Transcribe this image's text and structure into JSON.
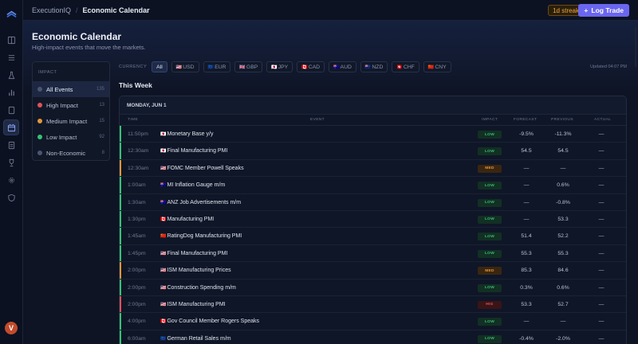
{
  "app": {
    "name": "ExecutionIQ",
    "page": "Economic Calendar",
    "streak": "1d streak",
    "log_trade": "Log Trade",
    "avatar_initial": "V"
  },
  "header": {
    "title": "Economic Calendar",
    "subtitle": "High-impact events that move the markets."
  },
  "impact_panel": {
    "label": "IMPACT",
    "items": [
      {
        "label": "All Events",
        "count": "135",
        "color": "#4a5575"
      },
      {
        "label": "High Impact",
        "count": "13",
        "color": "#e2525a"
      },
      {
        "label": "Medium Impact",
        "count": "15",
        "color": "#e5963a"
      },
      {
        "label": "Low Impact",
        "count": "92",
        "color": "#36c274"
      },
      {
        "label": "Non-Economic",
        "count": "8",
        "color": "#4a5575"
      }
    ]
  },
  "currency_filter": {
    "label": "CURRENCY",
    "chips": [
      {
        "flag": "",
        "code": "All"
      },
      {
        "flag": "🇺🇸",
        "code": "USD"
      },
      {
        "flag": "🇪🇺",
        "code": "EUR"
      },
      {
        "flag": "🇬🇧",
        "code": "GBP"
      },
      {
        "flag": "🇯🇵",
        "code": "JPY"
      },
      {
        "flag": "🇨🇦",
        "code": "CAD"
      },
      {
        "flag": "🇦🇺",
        "code": "AUD"
      },
      {
        "flag": "🇳🇿",
        "code": "NZD"
      },
      {
        "flag": "🇨🇭",
        "code": "CHF"
      },
      {
        "flag": "🇨🇳",
        "code": "CNY"
      }
    ],
    "updated": "Updated 04:07 PM"
  },
  "section_title": "This Week",
  "table": {
    "day": "MONDAY, JUN 1",
    "columns": {
      "time": "TIME",
      "event": "EVENT",
      "impact": "IMPACT",
      "forecast": "FORECAST",
      "previous": "PREVIOUS",
      "actual": "ACTUAL"
    },
    "rows": [
      {
        "time": "11:50pm",
        "flag": "🇯🇵",
        "event": "Monetary Base y/y",
        "impact": "LOW",
        "forecast": "-9.5%",
        "previous": "-11.3%",
        "actual": "—"
      },
      {
        "time": "12:30am",
        "flag": "🇯🇵",
        "event": "Final Manufacturing PMI",
        "impact": "LOW",
        "forecast": "54.5",
        "previous": "54.5",
        "actual": "—"
      },
      {
        "time": "12:30am",
        "flag": "🇺🇸",
        "event": "FOMC Member Powell Speaks",
        "impact": "MED",
        "forecast": "—",
        "previous": "—",
        "actual": "—"
      },
      {
        "time": "1:00am",
        "flag": "🇦🇺",
        "event": "MI Inflation Gauge m/m",
        "impact": "LOW",
        "forecast": "—",
        "previous": "0.6%",
        "actual": "—"
      },
      {
        "time": "1:30am",
        "flag": "🇦🇺",
        "event": "ANZ Job Advertisements m/m",
        "impact": "LOW",
        "forecast": "—",
        "previous": "-0.8%",
        "actual": "—"
      },
      {
        "time": "1:30pm",
        "flag": "🇨🇦",
        "event": "Manufacturing PMI",
        "impact": "LOW",
        "forecast": "—",
        "previous": "53.3",
        "actual": "—"
      },
      {
        "time": "1:45am",
        "flag": "🇨🇳",
        "event": "RatingDog Manufacturing PMI",
        "impact": "LOW",
        "forecast": "51.4",
        "previous": "52.2",
        "actual": "—"
      },
      {
        "time": "1:45pm",
        "flag": "🇺🇸",
        "event": "Final Manufacturing PMI",
        "impact": "LOW",
        "forecast": "55.3",
        "previous": "55.3",
        "actual": "—"
      },
      {
        "time": "2:00pm",
        "flag": "🇺🇸",
        "event": "ISM Manufacturing Prices",
        "impact": "MED",
        "forecast": "85.3",
        "previous": "84.6",
        "actual": "—"
      },
      {
        "time": "2:00pm",
        "flag": "🇺🇸",
        "event": "Construction Spending m/m",
        "impact": "LOW",
        "forecast": "0.3%",
        "previous": "0.6%",
        "actual": "—"
      },
      {
        "time": "2:00pm",
        "flag": "🇺🇸",
        "event": "ISM Manufacturing PMI",
        "impact": "HIGH",
        "forecast": "53.3",
        "previous": "52.7",
        "actual": "—"
      },
      {
        "time": "4:00pm",
        "flag": "🇨🇦",
        "event": "Gov Council Member Rogers Speaks",
        "impact": "LOW",
        "forecast": "—",
        "previous": "—",
        "actual": "—"
      },
      {
        "time": "6:00am",
        "flag": "🇪🇺",
        "event": "German Retail Sales m/m",
        "impact": "LOW",
        "forecast": "-0.4%",
        "previous": "-2.0%",
        "actual": "—"
      }
    ]
  },
  "colors": {
    "accent": "#6a66f0",
    "low": "#36c274",
    "medium": "#e5963a",
    "high": "#e2525a"
  }
}
